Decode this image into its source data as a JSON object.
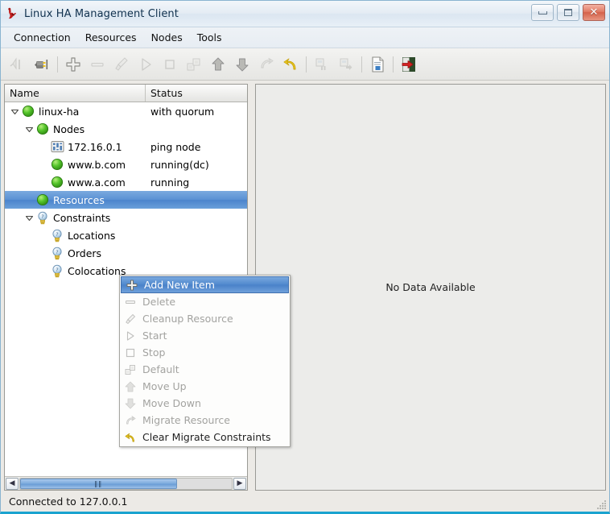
{
  "window": {
    "title": "Linux HA Management Client",
    "app_icon": "linux-ha-logo-icon",
    "buttons": {
      "minimize": "minimize-button",
      "maximize": "maximize-button",
      "close": "close-button",
      "close_glyph": "✕"
    }
  },
  "menubar": {
    "items": [
      {
        "label": "Connection"
      },
      {
        "label": "Resources"
      },
      {
        "label": "Nodes"
      },
      {
        "label": "Tools"
      }
    ]
  },
  "toolbar": {
    "buttons": [
      {
        "name": "connect-icon",
        "enabled": false
      },
      {
        "name": "disconnect-icon",
        "enabled": true
      },
      {
        "name": "separator",
        "enabled": false
      },
      {
        "name": "add-icon",
        "enabled": true
      },
      {
        "name": "remove-icon",
        "enabled": false
      },
      {
        "name": "cleanup-brush-icon",
        "enabled": false
      },
      {
        "name": "start-play-icon",
        "enabled": false
      },
      {
        "name": "stop-square-icon",
        "enabled": false
      },
      {
        "name": "default-gears-icon",
        "enabled": false
      },
      {
        "name": "move-up-icon",
        "enabled": true
      },
      {
        "name": "move-down-icon",
        "enabled": true
      },
      {
        "name": "migrate-arrow-icon",
        "enabled": false
      },
      {
        "name": "clear-migrate-undo-icon",
        "enabled": true
      },
      {
        "name": "separator",
        "enabled": false
      },
      {
        "name": "standby-node-icon",
        "enabled": false
      },
      {
        "name": "activate-node-icon",
        "enabled": false
      },
      {
        "name": "separator",
        "enabled": false
      },
      {
        "name": "document-cib-icon",
        "enabled": true
      },
      {
        "name": "separator",
        "enabled": false
      },
      {
        "name": "exit-door-icon",
        "enabled": true
      }
    ]
  },
  "tree": {
    "columns": {
      "name": "Name",
      "status": "Status"
    },
    "rows": [
      {
        "label": "linux-ha",
        "status": "with quorum",
        "icon": "green-ball-icon",
        "indent": 0,
        "twisty": "expanded",
        "selected": false
      },
      {
        "label": "Nodes",
        "status": "",
        "icon": "green-ball-icon",
        "indent": 1,
        "twisty": "expanded",
        "selected": false
      },
      {
        "label": "172.16.0.1",
        "status": "ping node",
        "icon": "ping-node-icon",
        "indent": 2,
        "twisty": "none",
        "selected": false
      },
      {
        "label": "www.b.com",
        "status": "running(dc)",
        "icon": "green-ball-icon",
        "indent": 2,
        "twisty": "none",
        "selected": false
      },
      {
        "label": "www.a.com",
        "status": "running",
        "icon": "green-ball-icon",
        "indent": 2,
        "twisty": "none",
        "selected": false
      },
      {
        "label": "Resources",
        "status": "",
        "icon": "green-ball-icon",
        "indent": 1,
        "twisty": "none",
        "selected": true
      },
      {
        "label": "Constraints",
        "status": "",
        "icon": "bulb-icon",
        "indent": 1,
        "twisty": "expanded",
        "selected": false
      },
      {
        "label": "Locations",
        "status": "",
        "icon": "bulb-icon",
        "indent": 2,
        "twisty": "none",
        "selected": false
      },
      {
        "label": "Orders",
        "status": "",
        "icon": "bulb-icon",
        "indent": 2,
        "twisty": "none",
        "selected": false
      },
      {
        "label": "Colocations",
        "status": "",
        "icon": "bulb-icon",
        "indent": 2,
        "twisty": "none",
        "selected": false
      }
    ],
    "scrollbar": {
      "left_arrow": "◀",
      "right_arrow": "▶",
      "thumb_grip": "‖‖"
    }
  },
  "context_menu": {
    "items": [
      {
        "label": "Add New Item",
        "icon": "plus-icon",
        "enabled": true,
        "highlighted": true
      },
      {
        "label": "Delete",
        "icon": "minus-icon",
        "enabled": false,
        "highlighted": false
      },
      {
        "label": "Cleanup Resource",
        "icon": "brush-icon",
        "enabled": false,
        "highlighted": false
      },
      {
        "label": "Start",
        "icon": "play-icon",
        "enabled": false,
        "highlighted": false
      },
      {
        "label": "Stop",
        "icon": "stop-icon",
        "enabled": false,
        "highlighted": false
      },
      {
        "label": "Default",
        "icon": "gears-icon",
        "enabled": false,
        "highlighted": false
      },
      {
        "label": "Move Up",
        "icon": "arrow-up-icon",
        "enabled": false,
        "highlighted": false
      },
      {
        "label": "Move Down",
        "icon": "arrow-down-icon",
        "enabled": false,
        "highlighted": false
      },
      {
        "label": "Migrate Resource",
        "icon": "migrate-arrow-icon",
        "enabled": false,
        "highlighted": false
      },
      {
        "label": "Clear Migrate Constraints",
        "icon": "undo-arrow-icon",
        "enabled": true,
        "highlighted": false
      }
    ]
  },
  "right_panel": {
    "empty_message": "No Data Available"
  },
  "statusbar": {
    "text": "Connected to 127.0.0.1",
    "grip": "resize-grip-icon"
  },
  "colors": {
    "accent_selection": "#5189ce",
    "node_green": "#4cbb2a",
    "close_red": "#d4614a",
    "window_border": "#8ab4d0",
    "desktop": "#0f7fa8"
  }
}
